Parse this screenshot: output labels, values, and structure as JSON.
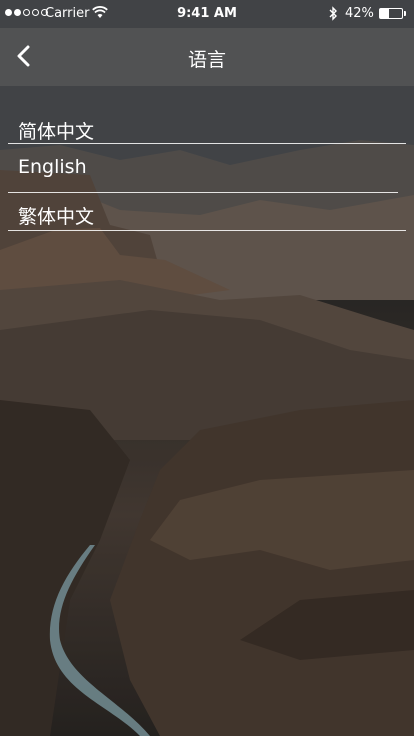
{
  "status_bar": {
    "carrier": "Carrier",
    "time": "9:41 AM",
    "battery_percent": "42%",
    "battery_level": 0.42,
    "signal_bars_filled": 2,
    "signal_bars_total": 5
  },
  "nav": {
    "title": "语言",
    "back_icon": "chevron-left-icon"
  },
  "languages": [
    {
      "label": "简体中文"
    },
    {
      "label": "English"
    },
    {
      "label": "繁体中文"
    }
  ],
  "colors": {
    "text": "#ffffff",
    "nav_background": "#5f5f5f"
  }
}
